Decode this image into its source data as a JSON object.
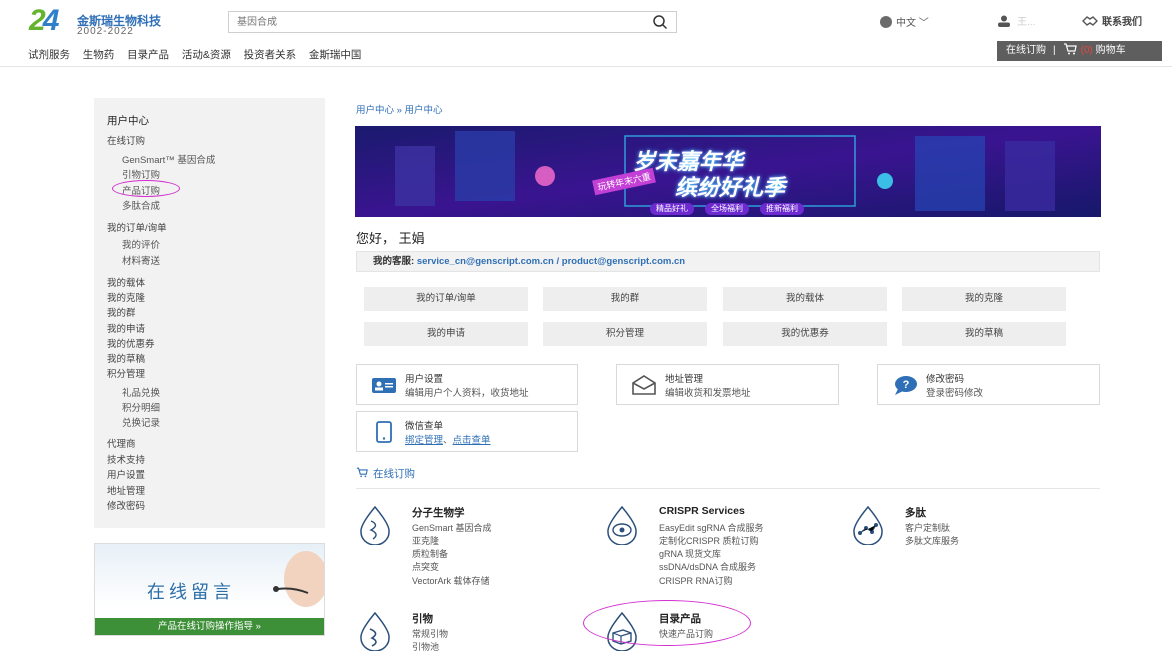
{
  "header": {
    "logo_number": "24",
    "logo_name": "金斯瑞生物科技",
    "logo_years": "2002-2022",
    "search_placeholder": "基因合成",
    "language": "中文",
    "user_name": "王...",
    "contact_label": "联系我们",
    "nav": [
      "试剂服务",
      "生物药",
      "目录产品",
      "活动&资源",
      "投资者关系",
      "金斯瑞中国"
    ],
    "online_order": "在线订购",
    "cart_count": "(0)",
    "cart_label": "购物车"
  },
  "sidebar": {
    "user_center": "用户中心",
    "online_order": "在线订购",
    "order_items": [
      "GenSmart™ 基因合成",
      "引物订购",
      "产品订购",
      "多肽合成"
    ],
    "my_orders": "我的订单/询单",
    "order_sub": [
      "我的评价",
      "材料寄送"
    ],
    "links_a": [
      "我的载体",
      "我的克隆",
      "我的群",
      "我的申请",
      "我的优惠券",
      "我的草稿",
      "积分管理"
    ],
    "points_sub": [
      "礼品兑换",
      "积分明细",
      "兑换记录"
    ],
    "links_b": [
      "代理商",
      "技术支持",
      "用户设置",
      "地址管理",
      "修改密码"
    ],
    "ad_title": "在线留言",
    "ad_button": "产品在线订购操作指导 »"
  },
  "main": {
    "breadcrumb": "用户中心 » 用户中心",
    "banner": {
      "line1": "岁末嘉年华",
      "line2": "缤纷好礼季",
      "tag": "玩转年末六重",
      "pills": [
        "精品好礼",
        "全场福利",
        "推新福利"
      ]
    },
    "greeting": "您好， 王娟",
    "service_label": "我的客服:",
    "service_emails": "service_cn@genscript.com.cn / product@genscript.com.cn",
    "quick_buttons": [
      "我的订单/询单",
      "我的群",
      "我的载体",
      "我的克隆",
      "我的申请",
      "积分管理",
      "我的优惠券",
      "我的草稿"
    ],
    "cards": [
      {
        "title": "用户设置",
        "desc": "编辑用户个人资料，收货地址"
      },
      {
        "title": "地址管理",
        "desc": "编辑收货和发票地址"
      },
      {
        "title": "修改密码",
        "desc": "登录密码修改"
      },
      {
        "title": "微信查单",
        "link1": "绑定管理",
        "sep": "、",
        "link2": "点击查单"
      }
    ],
    "online_title": "在线订购",
    "categories": [
      {
        "title": "分子生物学",
        "items": [
          "GenSmart 基因合成",
          "亚克隆",
          "质粒制备",
          "点突变",
          "VectorArk 载体存储"
        ]
      },
      {
        "title": "CRISPR Services",
        "items": [
          "EasyEdit sgRNA 合成服务",
          "定制化CRISPR 质粒订购",
          "gRNA 现货文库",
          "ssDNA/dsDNA 合成服务",
          "CRISPR RNA订购"
        ]
      },
      {
        "title": "多肽",
        "items": [
          "客户定制肽",
          "多肽文库服务"
        ]
      },
      {
        "title": "引物",
        "items": [
          "常规引物",
          "引物池"
        ]
      },
      {
        "title": "目录产品",
        "items": [
          "快速产品订购"
        ]
      }
    ]
  },
  "colors": {
    "accent_blue": "#2f6fb6",
    "highlight_magenta": "#d22fd0",
    "green": "#3d8f38"
  }
}
